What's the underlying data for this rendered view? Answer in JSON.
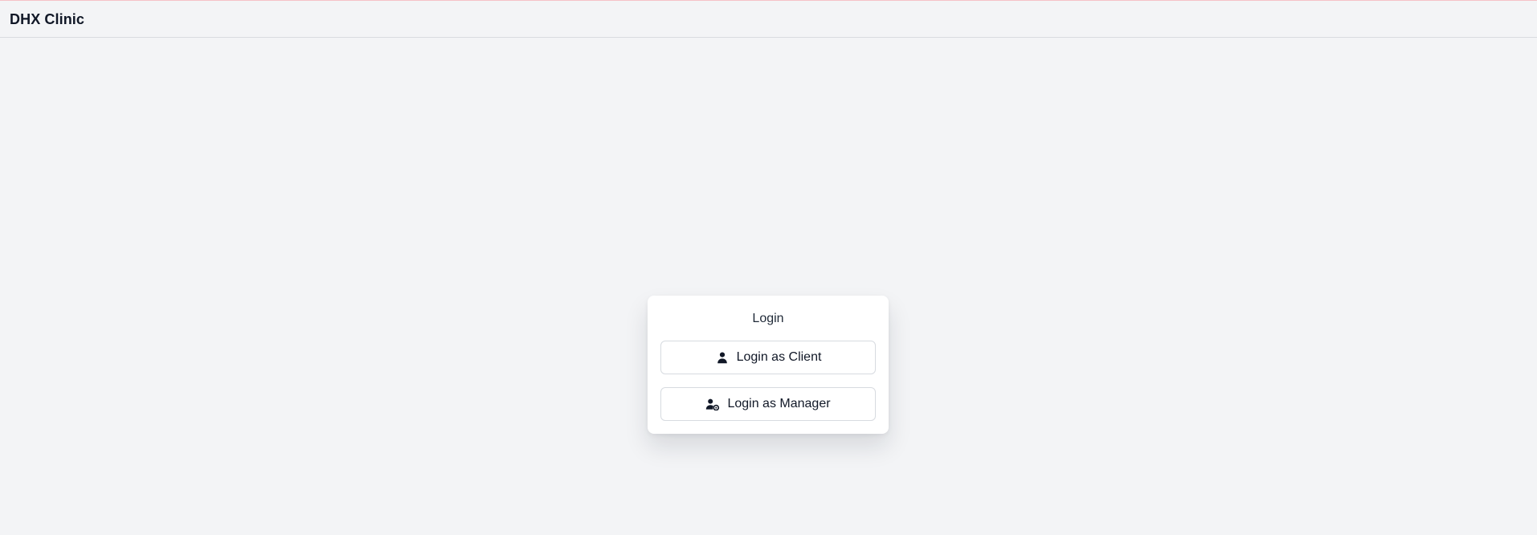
{
  "app": {
    "title": "DHX Clinic"
  },
  "login_card": {
    "title": "Login",
    "buttons": [
      {
        "label": "Login as Client",
        "icon": "user-icon"
      },
      {
        "label": "Login as Manager",
        "icon": "user-gear-icon"
      }
    ]
  },
  "colors": {
    "background": "#f3f4f6",
    "card": "#ffffff",
    "text": "#111827",
    "border": "#d7dbe0",
    "top_accent": "#f5c2c7"
  }
}
